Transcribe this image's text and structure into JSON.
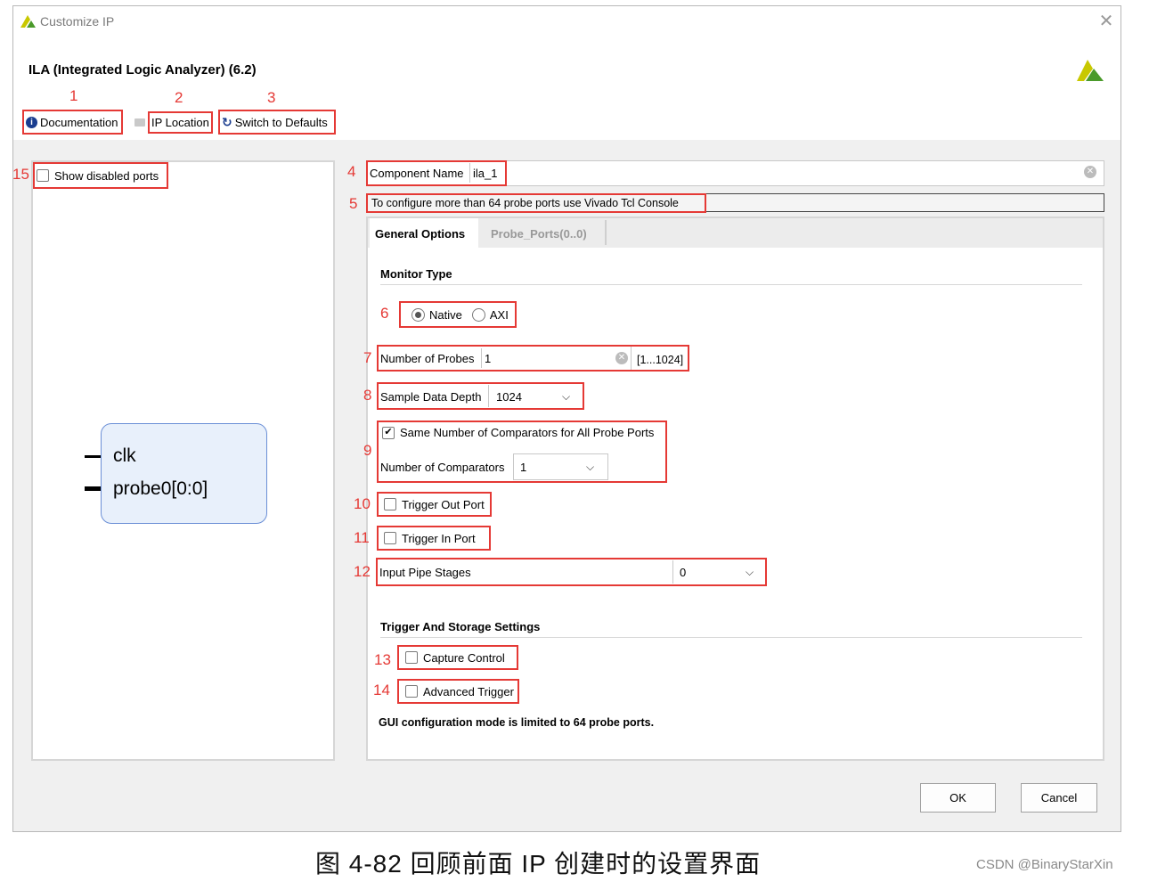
{
  "window": {
    "title": "Customize IP",
    "close_glyph": "✕"
  },
  "ip": {
    "title": "ILA (Integrated Logic Analyzer) (6.2)"
  },
  "toolbar": {
    "documentation": "Documentation",
    "ip_location": "IP Location",
    "switch_defaults": "Switch to Defaults"
  },
  "left": {
    "show_disabled": "Show disabled ports",
    "block_ports": [
      "clk",
      "probe0[0:0]"
    ]
  },
  "form": {
    "component_name_label": "Component Name",
    "component_name_value": "ila_1",
    "note": "To configure more than 64 probe ports use Vivado Tcl Console",
    "tabs": [
      "General Options",
      "Probe_Ports(0..0)"
    ],
    "monitor_type_title": "Monitor Type",
    "radio_native": "Native",
    "radio_axi": "AXI",
    "num_probes_label": "Number of Probes",
    "num_probes_value": "1",
    "num_probes_range": "[1...1024]",
    "sample_depth_label": "Sample Data Depth",
    "sample_depth_value": "1024",
    "same_comparators_label": "Same Number of Comparators for All Probe Ports",
    "num_comparators_label": "Number of Comparators",
    "num_comparators_value": "1",
    "trigger_out": "Trigger Out Port",
    "trigger_in": "Trigger In Port",
    "pipe_stages_label": "Input Pipe Stages",
    "pipe_stages_value": "0",
    "trigger_storage_title": "Trigger And Storage Settings",
    "capture_control": "Capture Control",
    "advanced_trigger": "Advanced Trigger",
    "limit_note": "GUI configuration mode is limited to 64 probe ports."
  },
  "buttons": {
    "ok": "OK",
    "cancel": "Cancel"
  },
  "annotations": [
    "1",
    "2",
    "3",
    "4",
    "5",
    "6",
    "7",
    "8",
    "9",
    "10",
    "11",
    "12",
    "13",
    "14",
    "15"
  ],
  "caption": "图 4-82 回顾前面 IP 创建时的设置界面",
  "watermark": "CSDN @BinaryStarXin",
  "colors": {
    "annotation_red": "#e53935",
    "logo_yellow": "#c8c800",
    "logo_green": "#4a9a2a",
    "block_fill": "#e8f0fb",
    "block_border": "#6b8fd6"
  }
}
